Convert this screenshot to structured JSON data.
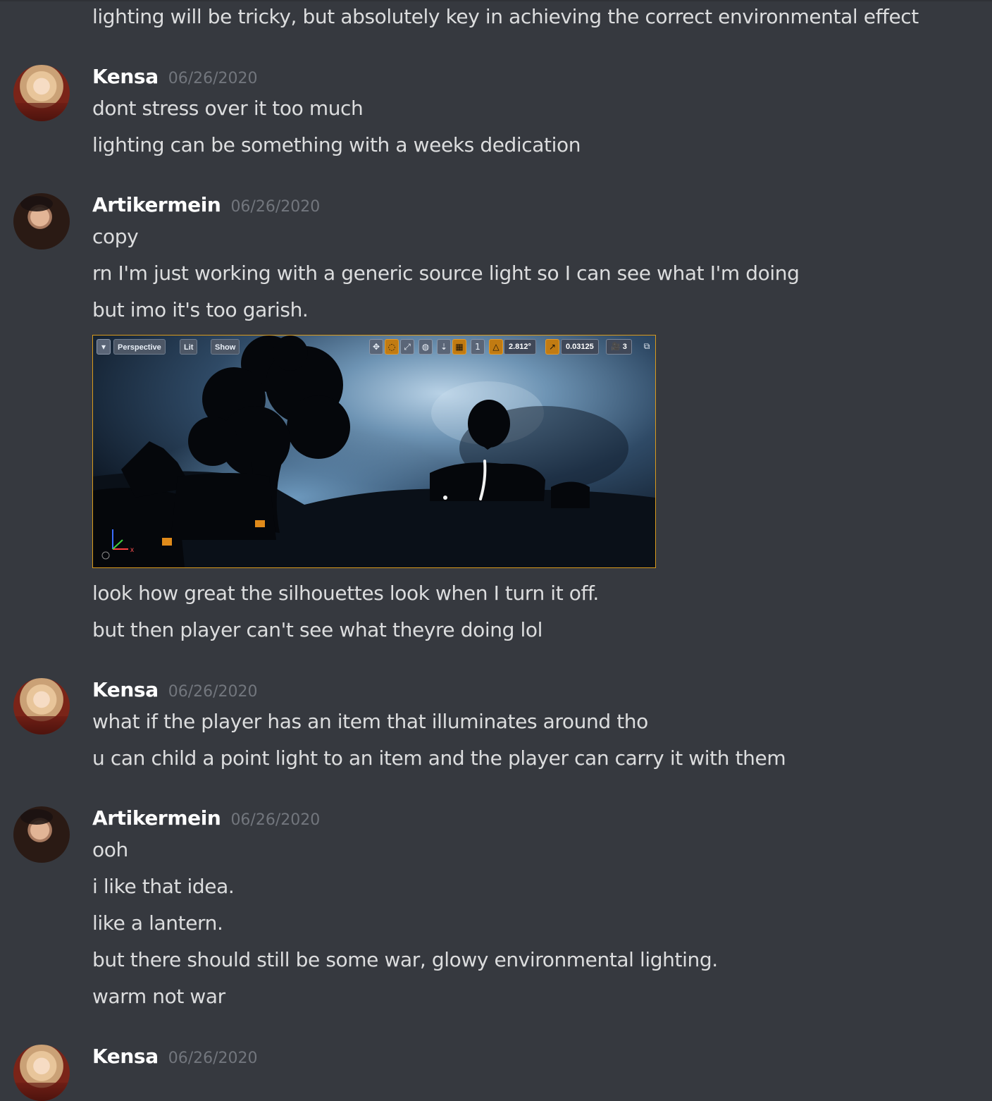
{
  "top_message": "lighting will be tricky, but absolutely key in achieving the correct environmental effect",
  "messages": [
    {
      "author": "Kensa",
      "timestamp": "06/26/2020",
      "avatar": "kensa-avatar",
      "lines": [
        "dont stress over it too much",
        "lighting can be something with a weeks dedication"
      ]
    },
    {
      "author": "Artikermein",
      "timestamp": "06/26/2020",
      "avatar": "artikermein-avatar",
      "lines": [
        "copy",
        "rn I'm just working with a generic source light so I can see what I'm doing",
        "but imo it's too garish."
      ],
      "lines_after": [
        "look how great the silhouettes look when I turn it off.",
        "but then player can't see what theyre doing lol"
      ]
    },
    {
      "author": "Kensa",
      "timestamp": "06/26/2020",
      "avatar": "kensa-avatar",
      "lines": [
        "what if the player has an item that illuminates around tho",
        "u can child a point light to an item and the player can carry it with them"
      ]
    },
    {
      "author": "Artikermein",
      "timestamp": "06/26/2020",
      "avatar": "artikermein-avatar",
      "lines": [
        "ooh",
        "i like that idea.",
        "like a lantern.",
        "but there should still be some war, glowy environmental lighting.",
        "warm not war"
      ]
    },
    {
      "author": "Kensa",
      "timestamp": "06/26/2020",
      "avatar": "kensa-avatar",
      "lines": []
    }
  ],
  "attachment": {
    "toolbar": {
      "perspective": "Perspective",
      "lit": "Lit",
      "show": "Show",
      "angle_snap": "2.812°",
      "scale_snap": "0.03125",
      "camera_speed": "3"
    },
    "axis_x_label": "x",
    "colors": {
      "frame_border": "#d89a1c",
      "sky": "#5f86a6",
      "silhouette": "#05070b",
      "ui_orange": "#c17b12"
    }
  },
  "colors": {
    "background": "#36393f",
    "text": "#dcddde",
    "username": "#ffffff",
    "timestamp": "#72767d"
  }
}
